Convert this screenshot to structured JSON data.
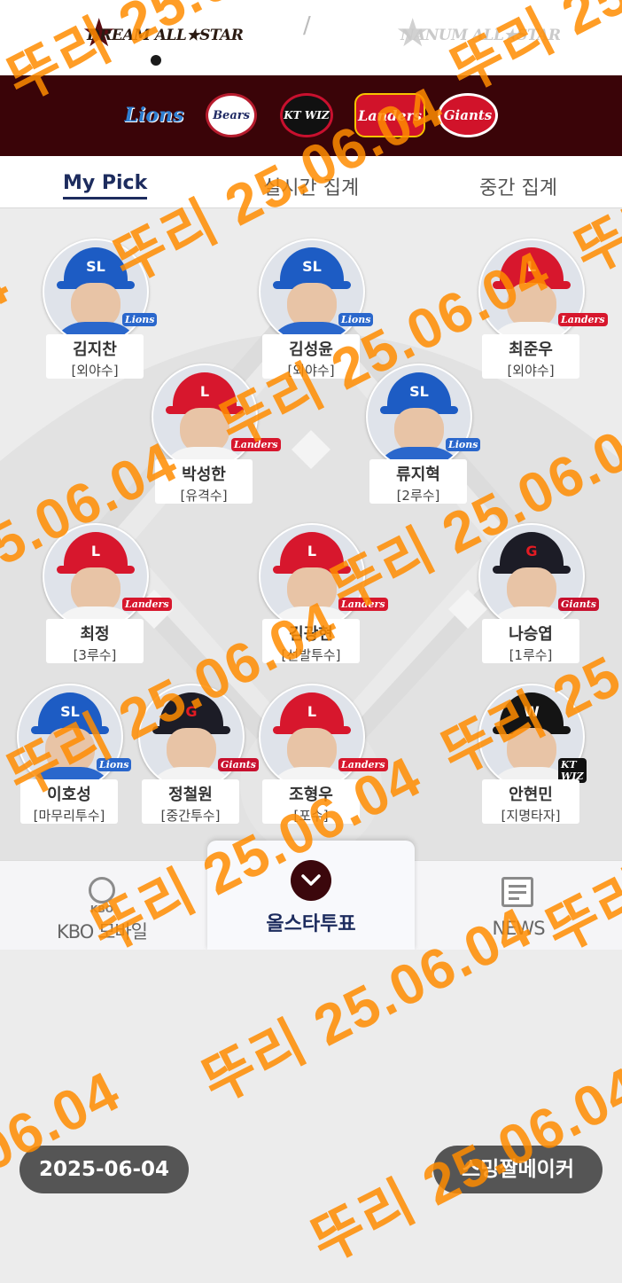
{
  "header": {
    "dream_league": "DREAM ALL★STAR",
    "nanum_league": "NANUM ALL★STAR",
    "divider": "/"
  },
  "teams": {
    "lions": "Lions",
    "bears": "Bears",
    "ktwiz": "KT WIZ",
    "landers": "Landers",
    "giants": "Giants"
  },
  "tabs": {
    "my_pick": "My Pick",
    "realtime": "실시간 집계",
    "interim": "중간 집계"
  },
  "players": [
    {
      "name": "김지찬",
      "position": "[외야수]",
      "team": "Lions"
    },
    {
      "name": "김성윤",
      "position": "[외야수]",
      "team": "Lions"
    },
    {
      "name": "최준우",
      "position": "[외야수]",
      "team": "Landers"
    },
    {
      "name": "박성한",
      "position": "[유격수]",
      "team": "Landers"
    },
    {
      "name": "류지혁",
      "position": "[2루수]",
      "team": "Lions"
    },
    {
      "name": "최정",
      "position": "[3루수]",
      "team": "Landers"
    },
    {
      "name": "김광현",
      "position": "[선발투수]",
      "team": "Landers"
    },
    {
      "name": "나승엽",
      "position": "[1루수]",
      "team": "Giants"
    },
    {
      "name": "이호성",
      "position": "[마무리투수]",
      "team": "Lions"
    },
    {
      "name": "정철원",
      "position": "[중간투수]",
      "team": "Giants"
    },
    {
      "name": "조형우",
      "position": "[포수]",
      "team": "Landers"
    },
    {
      "name": "안현민",
      "position": "[지명타자]",
      "team": "KT WIZ"
    }
  ],
  "bottom_nav": {
    "kbo_icon_text": "KBO",
    "kbo_mobile": "KBO 모바일",
    "vote": "올스타투표",
    "news": "NEWS"
  },
  "footer": {
    "date": "2025-06-04",
    "maker": "스밍짤메이커"
  },
  "watermark": "뚜리 25.06.04",
  "colors": {
    "team_bar": "#3a0408",
    "tab_active": "#1d2c5e",
    "watermark": "#ff8c00",
    "pill": "#555555"
  }
}
